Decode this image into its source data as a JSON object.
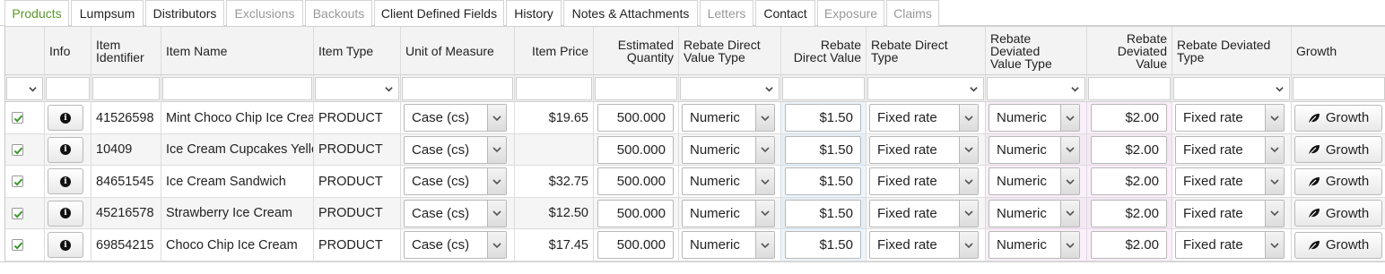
{
  "tabs": [
    {
      "label": "Products",
      "state": "active"
    },
    {
      "label": "Lumpsum",
      "state": "normal"
    },
    {
      "label": "Distributors",
      "state": "normal"
    },
    {
      "label": "Exclusions",
      "state": "disabled"
    },
    {
      "label": "Backouts",
      "state": "disabled"
    },
    {
      "label": "Client Defined Fields",
      "state": "normal"
    },
    {
      "label": "History",
      "state": "normal"
    },
    {
      "label": "Notes & Attachments",
      "state": "normal"
    },
    {
      "label": "Letters",
      "state": "disabled"
    },
    {
      "label": "Contact",
      "state": "normal"
    },
    {
      "label": "Exposure",
      "state": "disabled"
    },
    {
      "label": "Claims",
      "state": "disabled"
    }
  ],
  "columns": {
    "info": "Info",
    "item_identifier": [
      "Item",
      "Identifier"
    ],
    "item_name": "Item Name",
    "item_type": "Item Type",
    "unit_of_measure": "Unit of Measure",
    "item_price": "Item Price",
    "estimated_quantity": [
      "Estimated",
      "Quantity"
    ],
    "rebate_direct_value_type": [
      "Rebate Direct",
      "Value Type"
    ],
    "rebate_direct_value": [
      "Rebate",
      "Direct Value"
    ],
    "rebate_direct_type": [
      "Rebate Direct",
      "Type"
    ],
    "rebate_deviated_value_type": [
      "Rebate",
      "Deviated",
      "Value Type"
    ],
    "rebate_deviated_value": [
      "Rebate",
      "Deviated",
      "Value"
    ],
    "rebate_deviated_type": [
      "Rebate Deviated",
      "Type"
    ],
    "growth": "Growth"
  },
  "rows": [
    {
      "checked": true,
      "identifier": "41526598",
      "name": "Mint Choco Chip Ice Cream",
      "type": "PRODUCT",
      "uom": "Case (cs)",
      "price": "$19.65",
      "quantity": "500.000",
      "direct_value_type": "Numeric",
      "direct_value": "$1.50",
      "direct_type": "Fixed rate",
      "deviated_value_type": "Numeric",
      "deviated_value": "$2.00",
      "deviated_type": "Fixed rate",
      "growth_label": "Growth"
    },
    {
      "checked": true,
      "identifier": "10409",
      "name": "Ice Cream Cupcakes Yellow",
      "type": "PRODUCT",
      "uom": "Case (cs)",
      "price": "",
      "quantity": "500.000",
      "direct_value_type": "Numeric",
      "direct_value": "$1.50",
      "direct_type": "Fixed rate",
      "deviated_value_type": "Numeric",
      "deviated_value": "$2.00",
      "deviated_type": "Fixed rate",
      "growth_label": "Growth"
    },
    {
      "checked": true,
      "identifier": "84651545",
      "name": "Ice Cream Sandwich",
      "type": "PRODUCT",
      "uom": "Case (cs)",
      "price": "$32.75",
      "quantity": "500.000",
      "direct_value_type": "Numeric",
      "direct_value": "$1.50",
      "direct_type": "Fixed rate",
      "deviated_value_type": "Numeric",
      "deviated_value": "$2.00",
      "deviated_type": "Fixed rate",
      "growth_label": "Growth"
    },
    {
      "checked": true,
      "identifier": "45216578",
      "name": "Strawberry Ice Cream",
      "type": "PRODUCT",
      "uom": "Case (cs)",
      "price": "$12.50",
      "quantity": "500.000",
      "direct_value_type": "Numeric",
      "direct_value": "$1.50",
      "direct_type": "Fixed rate",
      "deviated_value_type": "Numeric",
      "deviated_value": "$2.00",
      "deviated_type": "Fixed rate",
      "growth_label": "Growth"
    },
    {
      "checked": true,
      "identifier": "69854215",
      "name": "Choco Chip Ice Cream",
      "type": "PRODUCT",
      "uom": "Case (cs)",
      "price": "$17.45",
      "quantity": "500.000",
      "direct_value_type": "Numeric",
      "direct_value": "$1.50",
      "direct_type": "Fixed rate",
      "deviated_value_type": "Numeric",
      "deviated_value": "$2.00",
      "deviated_type": "Fixed rate",
      "growth_label": "Growth"
    }
  ],
  "colors": {
    "active_tab": "#5a9a2a",
    "disabled_tab": "#999999",
    "check": "#3a9a2a"
  }
}
